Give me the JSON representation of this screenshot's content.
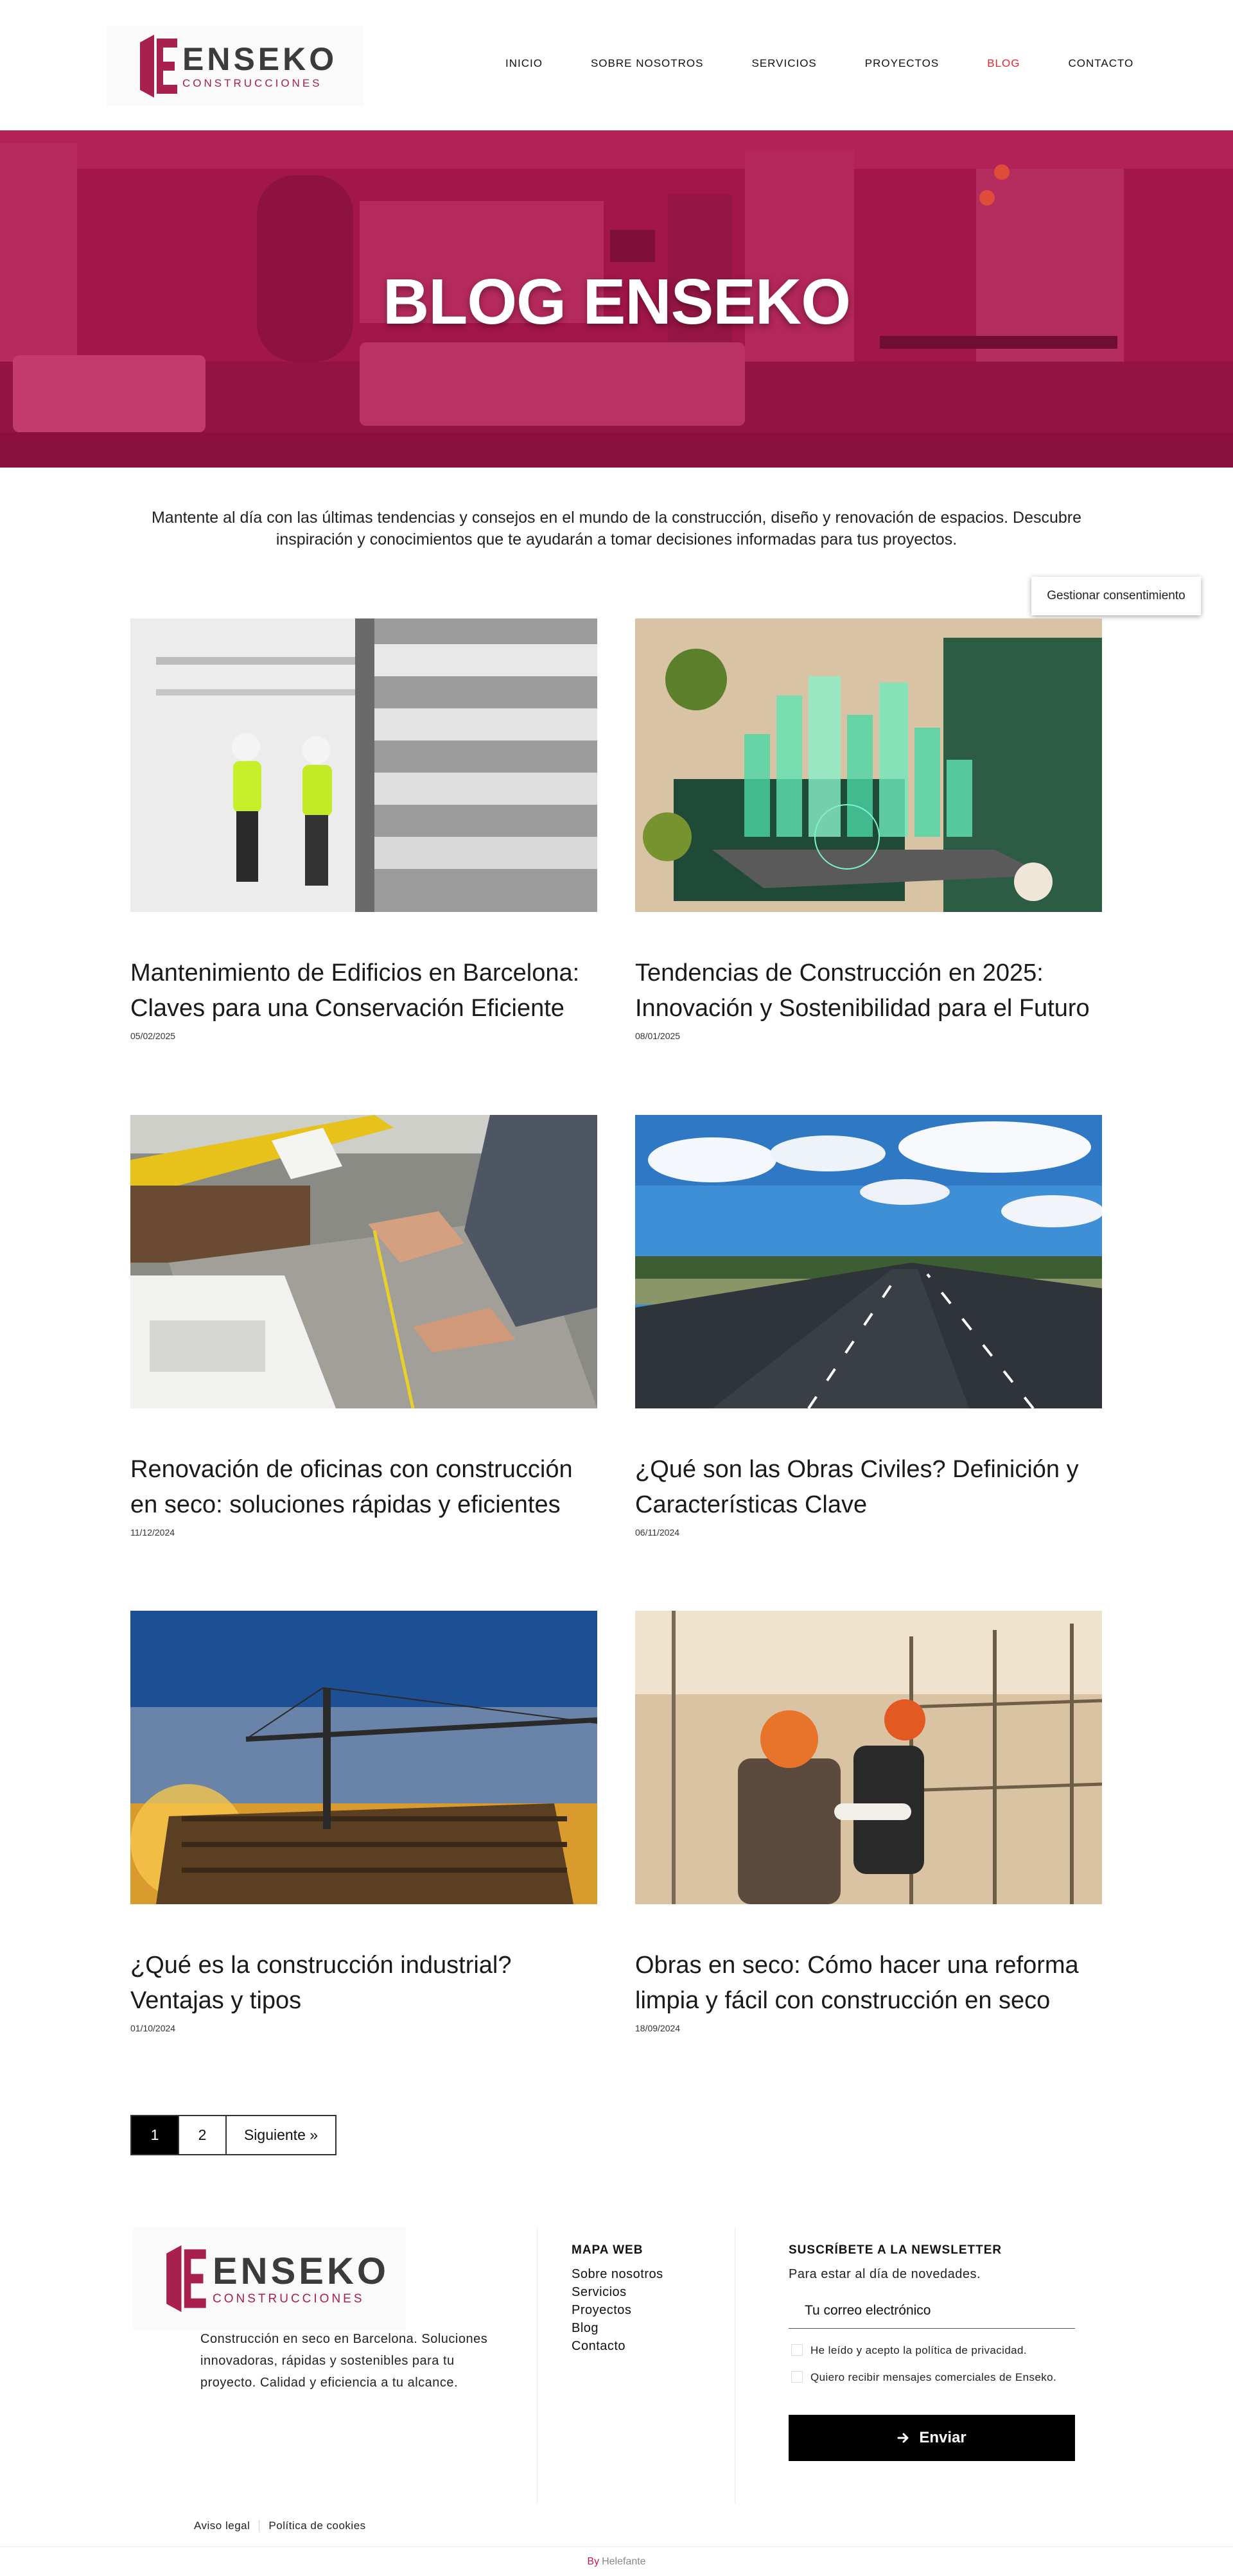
{
  "brand": {
    "name": "ENSEKO",
    "subtitle": "CONSTRUCCIONES",
    "colors": {
      "primary": "#a3164a",
      "active_nav": "#e5252e",
      "button": "#000000"
    }
  },
  "nav": {
    "items": [
      "INICIO",
      "SOBRE NOSOTROS",
      "SERVICIOS",
      "PROYECTOS",
      "BLOG",
      "CONTACTO"
    ],
    "active": "BLOG"
  },
  "hero": {
    "title": "BLOG ENSEKO"
  },
  "intro": "Mantente al día con las últimas tendencias y consejos en el mundo de la construcción, diseño y renovación de espacios. Descubre inspiración y conocimientos que te ayudarán a tomar decisiones informadas para tus proyectos.",
  "consent_button": "Gestionar consentimiento",
  "posts": [
    {
      "title": "Mantenimiento de Edificios en Barcelona: Claves para una Conservación Eficiente",
      "date": "05/02/2025",
      "image": "workers-in-high-vis-vests-photo"
    },
    {
      "title": "Tendencias de Construcción en 2025: Innovación y Sostenibilidad para el Futuro",
      "date": "08/01/2025",
      "image": "holographic-city-on-tablet-photo"
    },
    {
      "title": "Renovación de oficinas con construcción en seco: soluciones rápidas y eficientes",
      "date": "11/12/2024",
      "image": "measuring-drywall-board-photo"
    },
    {
      "title": "¿Qué son las Obras Civiles? Definición y Características Clave",
      "date": "06/11/2024",
      "image": "highway-under-blue-sky-photo"
    },
    {
      "title": "¿Qué es la construcción industrial? Ventajas y tipos",
      "date": "01/10/2024",
      "image": "crane-over-building-at-sunset-photo"
    },
    {
      "title": "Obras en seco: Cómo hacer una reforma limpia y fácil con construcción en seco",
      "date": "18/09/2024",
      "image": "workers-with-orange-helmets-photo"
    }
  ],
  "pagination": {
    "current": "1",
    "pages": [
      "2"
    ],
    "next": "Siguiente »"
  },
  "footer": {
    "description": "Construcción en seco en Barcelona. Soluciones innovadoras, rápidas y sostenibles para tu proyecto. Calidad y eficiencia a tu alcance.",
    "sitemap": {
      "title": "MAPA WEB",
      "links": [
        "Sobre nosotros",
        "Servicios",
        "Proyectos",
        "Blog",
        "Contacto"
      ]
    },
    "newsletter": {
      "title": "SUSCRÍBETE A LA NEWSLETTER",
      "subtitle": "Para estar al día de novedades.",
      "email_placeholder": "Tu correo electrónico",
      "privacy_check": "He leído y acepto la política de privacidad.",
      "commercial_check": "Quiero recibir mensajes comerciales de Enseko.",
      "submit": "Enviar"
    },
    "legal": [
      "Aviso legal",
      "Política de cookies"
    ],
    "credit_by": "By",
    "credit_name": "Helefante"
  }
}
